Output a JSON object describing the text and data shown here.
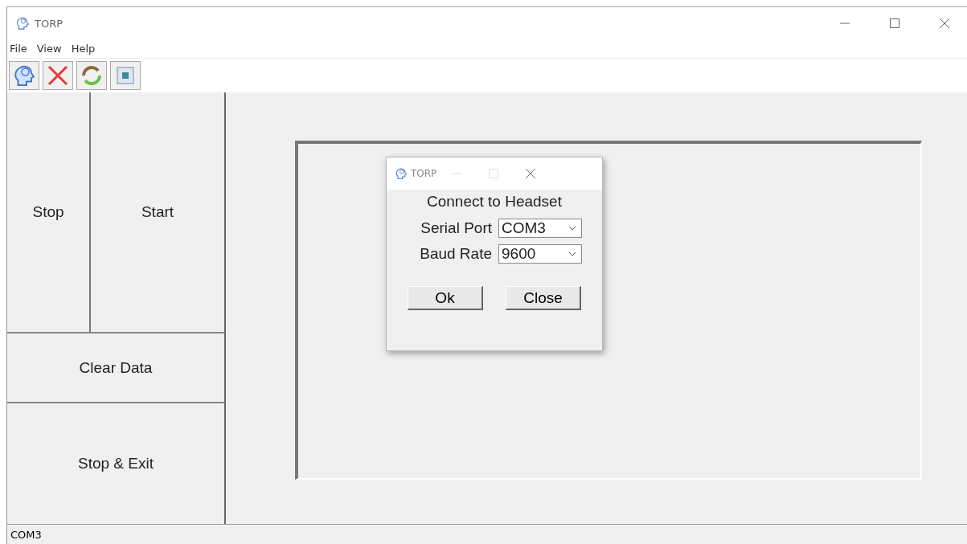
{
  "window": {
    "title": "TORP"
  },
  "menu": [
    "File",
    "View",
    "Help"
  ],
  "toolbar": [
    {
      "kind": "brain"
    },
    {
      "kind": "cross"
    },
    {
      "kind": "refresh"
    },
    {
      "kind": "capture"
    }
  ],
  "controls": {
    "stop": "Stop",
    "start": "Start",
    "clear": "Clear Data",
    "exit": "Stop & Exit"
  },
  "dialog": {
    "title": "TORP",
    "heading": "Connect to Headset",
    "fields": [
      {
        "label": "Serial Port",
        "value": "COM3"
      },
      {
        "label": "Baud Rate",
        "value": "9600"
      }
    ],
    "buttons": [
      "Ok",
      "Close"
    ]
  },
  "status_bar": "COM3"
}
